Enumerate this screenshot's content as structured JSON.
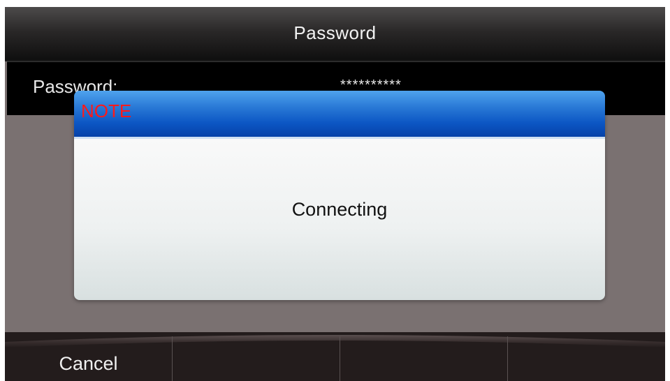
{
  "header": {
    "title": "Password"
  },
  "field": {
    "label": "Password:",
    "value": "**********"
  },
  "dialog": {
    "title": "NOTE",
    "message": "Connecting"
  },
  "softkeys": [
    {
      "label": "Cancel"
    },
    {
      "label": ""
    },
    {
      "label": ""
    },
    {
      "label": ""
    }
  ],
  "colors": {
    "background": "#7a7171",
    "dialog_header": "#0c56c4",
    "dialog_title": "#ff1a1a",
    "softkey_bar": "#231c1c"
  }
}
